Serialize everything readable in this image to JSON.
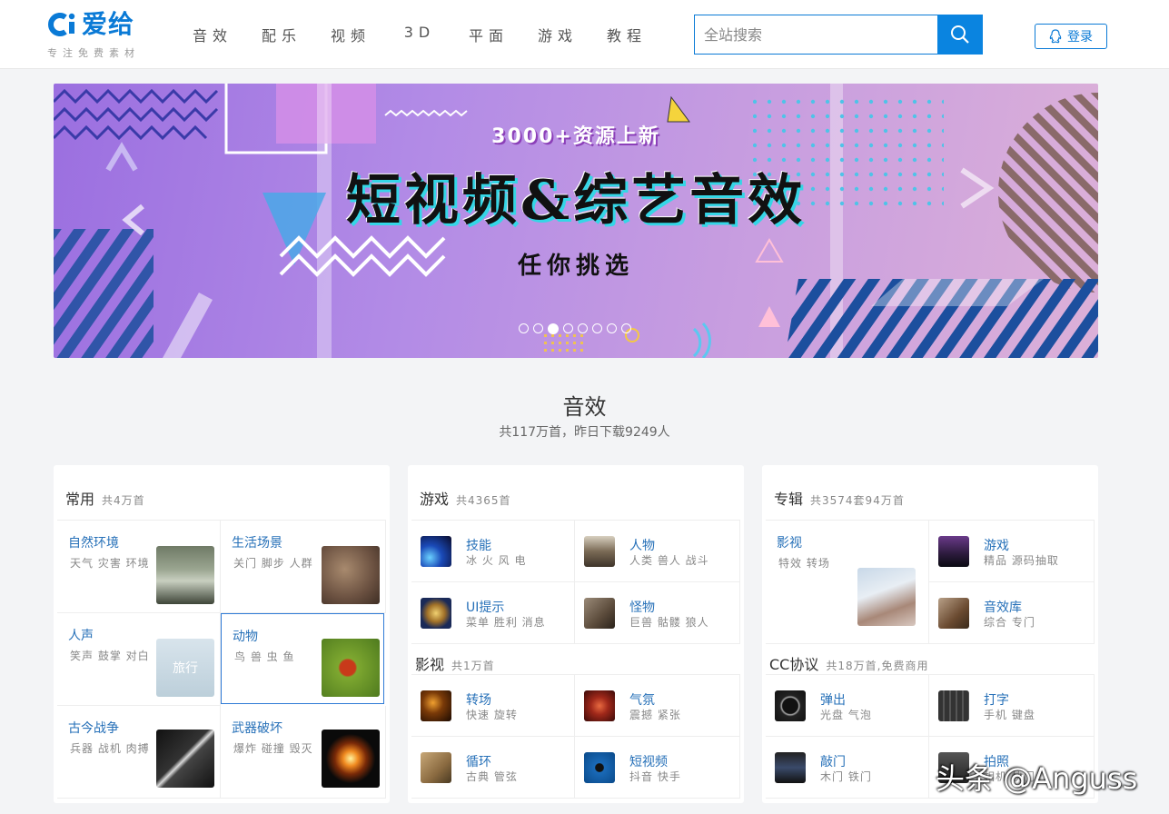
{
  "header": {
    "logo_word": "爱给",
    "logo_tagline": "专注免费素材",
    "nav": [
      "音效",
      "配乐",
      "视频",
      "3D",
      "平面",
      "游戏",
      "教程"
    ],
    "search_placeholder": "全站搜索",
    "login_label": "登录"
  },
  "banner": {
    "top_text": "3000+资源上新",
    "main_text": "短视频&综艺音效",
    "bottom_text": "任你挑选",
    "dot_count": 8,
    "active_dot_index": 2
  },
  "section": {
    "title": "音效",
    "subtitle": "共117万首，昨日下载9249人"
  },
  "cards": {
    "common": {
      "title": "常用",
      "count": "共4万首",
      "items": [
        {
          "title": "自然环境",
          "desc": "天气 灾害 环境"
        },
        {
          "title": "生活场景",
          "desc": "关门 脚步 人群"
        },
        {
          "title": "人声",
          "desc": "笑声 鼓掌 对白"
        },
        {
          "title": "动物",
          "desc": "鸟 兽 虫 鱼"
        },
        {
          "title": "古今战争",
          "desc": "兵器 战机 肉搏"
        },
        {
          "title": "武器破坏",
          "desc": "爆炸 碰撞 毁灭"
        }
      ],
      "thumb_text": "旅行"
    },
    "game": {
      "title": "游戏",
      "count": "共4365首",
      "items": [
        {
          "title": "技能",
          "desc": "冰 火 风 电"
        },
        {
          "title": "人物",
          "desc": "人类 兽人 战斗"
        },
        {
          "title": "UI提示",
          "desc": "菜单 胜利 消息"
        },
        {
          "title": "怪物",
          "desc": "巨兽 骷髅 狼人"
        }
      ],
      "sub_title": "影视",
      "sub_count": "共1万首",
      "sub_items": [
        {
          "title": "转场",
          "desc": "快速 旋转"
        },
        {
          "title": "气氛",
          "desc": "震撼 紧张"
        },
        {
          "title": "循环",
          "desc": "古典 管弦"
        },
        {
          "title": "短视频",
          "desc": "抖音 快手"
        }
      ]
    },
    "album": {
      "title": "专辑",
      "count": "共3574套94万首",
      "feature": {
        "title": "影视",
        "desc": "特效 转场"
      },
      "items": [
        {
          "title": "游戏",
          "desc": "精品 源码抽取"
        },
        {
          "title": "音效库",
          "desc": "综合 专门"
        }
      ],
      "sub_title": "CC协议",
      "sub_count": "共18万首,免费商用",
      "sub_items": [
        {
          "title": "弹出",
          "desc": "光盘 气泡"
        },
        {
          "title": "打字",
          "desc": "手机 键盘"
        },
        {
          "title": "敲门",
          "desc": "木门 铁门"
        },
        {
          "title": "拍照",
          "desc": "相机 快门"
        }
      ]
    }
  },
  "watermark": "头条 @Anguss",
  "colors": {
    "brand": "#0a7ad6",
    "link": "#2670b8"
  }
}
